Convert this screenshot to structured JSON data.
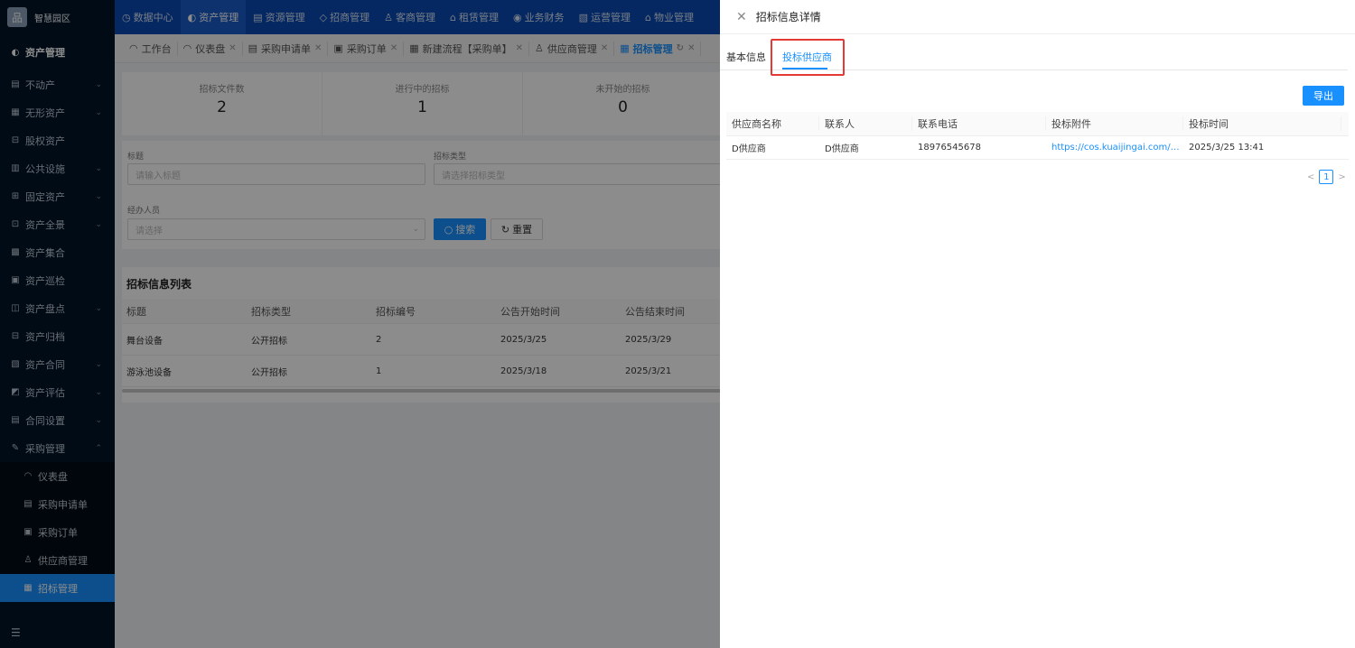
{
  "app": {
    "logo_text": "智慧园区",
    "logo_glyph": "品"
  },
  "top_nav": [
    {
      "icon": "◷",
      "label": "数据中心"
    },
    {
      "icon": "◐",
      "label": "资产管理",
      "active": true
    },
    {
      "icon": "▤",
      "label": "资源管理"
    },
    {
      "icon": "◇",
      "label": "招商管理"
    },
    {
      "icon": "♙",
      "label": "客商管理"
    },
    {
      "icon": "⌂",
      "label": "租赁管理"
    },
    {
      "icon": "◉",
      "label": "业务财务"
    },
    {
      "icon": "▧",
      "label": "运营管理"
    },
    {
      "icon": "⌂",
      "label": "物业管理"
    }
  ],
  "sidebar": {
    "section": "资产管理",
    "items": [
      {
        "icon": "▤",
        "label": "不动产",
        "chevron": "⌄"
      },
      {
        "icon": "▦",
        "label": "无形资产",
        "chevron": "⌄"
      },
      {
        "icon": "⊟",
        "label": "股权资产",
        "chevron": ""
      },
      {
        "icon": "▥",
        "label": "公共设施",
        "chevron": "⌄"
      },
      {
        "icon": "⊞",
        "label": "固定资产",
        "chevron": "⌄"
      },
      {
        "icon": "⊡",
        "label": "资产全景",
        "chevron": "⌄"
      },
      {
        "icon": "▩",
        "label": "资产集合",
        "chevron": ""
      },
      {
        "icon": "▣",
        "label": "资产巡检",
        "chevron": ""
      },
      {
        "icon": "◫",
        "label": "资产盘点",
        "chevron": "⌄"
      },
      {
        "icon": "⊟",
        "label": "资产归档",
        "chevron": ""
      },
      {
        "icon": "▧",
        "label": "资产合同",
        "chevron": "⌄"
      },
      {
        "icon": "◩",
        "label": "资产评估",
        "chevron": "⌄"
      },
      {
        "icon": "▤",
        "label": "合同设置",
        "chevron": "⌄"
      },
      {
        "icon": "✎",
        "label": "采购管理",
        "chevron": "⌃"
      }
    ],
    "sub_items": [
      {
        "icon": "◠",
        "label": "仪表盘"
      },
      {
        "icon": "▤",
        "label": "采购申请单"
      },
      {
        "icon": "▣",
        "label": "采购订单"
      },
      {
        "icon": "♙",
        "label": "供应商管理"
      },
      {
        "icon": "▦",
        "label": "招标管理",
        "active": true
      }
    ],
    "collapse_icon": "☰"
  },
  "tabs": [
    {
      "icon": "◠",
      "label": "工作台",
      "closable": false
    },
    {
      "icon": "◠",
      "label": "仪表盘",
      "closable": true
    },
    {
      "icon": "▤",
      "label": "采购申请单",
      "closable": true
    },
    {
      "icon": "▣",
      "label": "采购订单",
      "closable": true
    },
    {
      "icon": "▦",
      "label": "新建流程【采购单】",
      "closable": true
    },
    {
      "icon": "♙",
      "label": "供应商管理",
      "closable": true
    },
    {
      "icon": "▦",
      "label": "招标管理",
      "closable": true,
      "active": true
    }
  ],
  "stats": [
    {
      "label": "招标文件数",
      "value": "2"
    },
    {
      "label": "进行中的招标",
      "value": "1"
    },
    {
      "label": "未开始的招标",
      "value": "0"
    }
  ],
  "filters": {
    "title_label": "标题",
    "title_placeholder": "请输入标题",
    "type_label": "招标类型",
    "type_placeholder": "请选择招标类型",
    "handler_label": "经办人员",
    "handler_placeholder": "请选择",
    "search_label": "搜索",
    "reset_label": "重置"
  },
  "list": {
    "title": "招标信息列表",
    "columns": [
      "标题",
      "招标类型",
      "招标编号",
      "公告开始时间",
      "公告结束时间"
    ],
    "rows": [
      [
        "舞台设备",
        "公开招标",
        "2",
        "2025/3/25",
        "2025/3/29"
      ],
      [
        "游泳池设备",
        "公开招标",
        "1",
        "2025/3/18",
        "2025/3/21"
      ]
    ]
  },
  "drawer": {
    "title": "招标信息详情",
    "tabs": [
      {
        "label": "基本信息",
        "active": false
      },
      {
        "label": "投标供应商",
        "active": true
      }
    ],
    "export_label": "导出",
    "columns": [
      "供应商名称",
      "联系人",
      "联系电话",
      "投标附件",
      "投标时间"
    ],
    "rows": [
      [
        "D供应商",
        "D供应商",
        "18976545678",
        "https://cos.kuaijingai.com/upload/o...",
        "2025/3/25 13:41"
      ]
    ],
    "pagination": {
      "current": "1",
      "prev": "<",
      "next": ">"
    }
  }
}
